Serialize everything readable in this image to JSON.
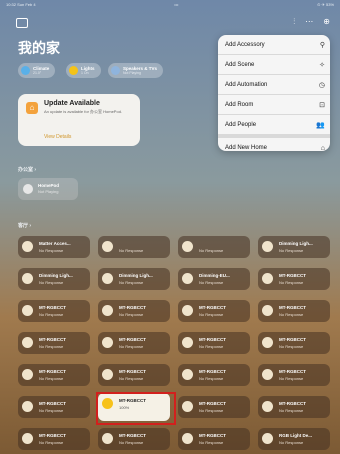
{
  "status_bar": {
    "left": "10:32  Sun Feb 4",
    "center": "•••",
    "right": "⊙ ✈ 53%"
  },
  "page_title": "我的家",
  "categories": [
    {
      "label": "Climate",
      "sub": "21.0°",
      "color": "#5ab0e8"
    },
    {
      "label": "Lights",
      "sub": "1 On",
      "color": "#f4c318"
    },
    {
      "label": "Speakers & TVs",
      "sub": "Not Playing",
      "color": "#8fb4dd"
    }
  ],
  "update_card": {
    "title": "Update Available",
    "subtitle": "An update is available for 办公室 HomePod.",
    "link": "View Details"
  },
  "section_office": "办公室 ›",
  "homepod": {
    "name": "HomePod",
    "sub": "Not Playing"
  },
  "section_default": "客厅 ›",
  "tiles": [
    {
      "name": "Matter Acces...",
      "sub": "No Response"
    },
    {
      "name": "",
      "sub": "No Response"
    },
    {
      "name": "",
      "sub": "No Response"
    },
    {
      "name": "Dimming Ligh...",
      "sub": "No Response"
    },
    {
      "name": "Dimming Ligh...",
      "sub": "No Response"
    },
    {
      "name": "Dimming Ligh...",
      "sub": "No Response"
    },
    {
      "name": "Dimming-EU...",
      "sub": "No Response"
    },
    {
      "name": "MT-RGBCCT",
      "sub": "No Response"
    },
    {
      "name": "MT-RGBCCT",
      "sub": "No Response"
    },
    {
      "name": "MT-RGBCCT",
      "sub": "No Response"
    },
    {
      "name": "MT-RGBCCT",
      "sub": "No Response"
    },
    {
      "name": "MT-RGBCCT",
      "sub": "No Response"
    },
    {
      "name": "MT-RGBCCT",
      "sub": "No Response"
    },
    {
      "name": "MT-RGBCCT",
      "sub": "No Response"
    },
    {
      "name": "MT-RGBCCT",
      "sub": "No Response"
    },
    {
      "name": "MT-RGBCCT",
      "sub": "No Response"
    },
    {
      "name": "MT-RGBCCT",
      "sub": "No Response"
    },
    {
      "name": "MT-RGBCCT",
      "sub": "No Response"
    },
    {
      "name": "MT-RGBCCT",
      "sub": "No Response"
    },
    {
      "name": "MT-RGBCCT",
      "sub": "No Response"
    },
    {
      "name": "MT-RGBCCT",
      "sub": "No Response"
    },
    {
      "name": "MT-RGBCCT",
      "sub": "100%",
      "on": true
    },
    {
      "name": "MT-RGBCCT",
      "sub": "No Response"
    },
    {
      "name": "MT-RGBCCT",
      "sub": "No Response"
    },
    {
      "name": "MT-RGBCCT",
      "sub": "No Response"
    },
    {
      "name": "MT-RGBCCT",
      "sub": "No Response"
    },
    {
      "name": "MT-RGBCCT",
      "sub": "No Response"
    },
    {
      "name": "RGB Light De...",
      "sub": "No Response"
    }
  ],
  "menu": [
    {
      "label": "Add Accessory",
      "icon": "⚲"
    },
    {
      "label": "Add Scene",
      "icon": "✧"
    },
    {
      "label": "Add Automation",
      "icon": "◷"
    },
    {
      "label": "Add Room",
      "icon": "⊡"
    },
    {
      "label": "Add People",
      "icon": "👥"
    },
    {
      "label": "Add New Home",
      "icon": "⌂"
    }
  ]
}
